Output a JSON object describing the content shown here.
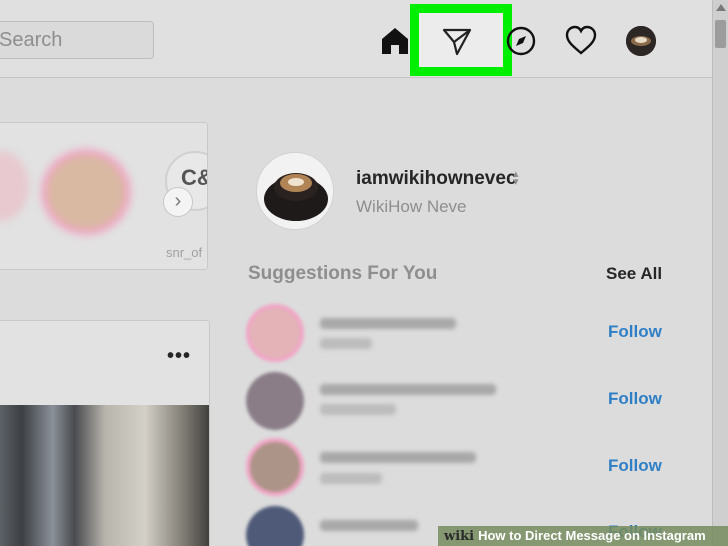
{
  "header": {
    "search_placeholder": "Search",
    "icons": [
      "home-icon",
      "direct-message-icon",
      "explore-icon",
      "activity-heart-icon",
      "profile-avatar"
    ]
  },
  "stories": {
    "partial_name": "snr_of",
    "partial_logo": "C&"
  },
  "post": {
    "more_label": "•••"
  },
  "profile": {
    "username": "iamwikihownevec",
    "full_name": "WikiHow Neve"
  },
  "suggestions": {
    "heading": "Suggestions For You",
    "see_all": "See All",
    "items": [
      {
        "follow": "Follow"
      },
      {
        "follow": "Follow"
      },
      {
        "follow": "Follow",
        "subtitle": "Follows you"
      },
      {
        "follow": "Follow"
      }
    ]
  },
  "watermark": {
    "brand": "wiki",
    "how": "How",
    "text": "to Direct Message on Instagram"
  },
  "colors": {
    "highlight": "#00ef00",
    "follow_blue": "#2f7fc6",
    "background": "#dcdcdc"
  }
}
